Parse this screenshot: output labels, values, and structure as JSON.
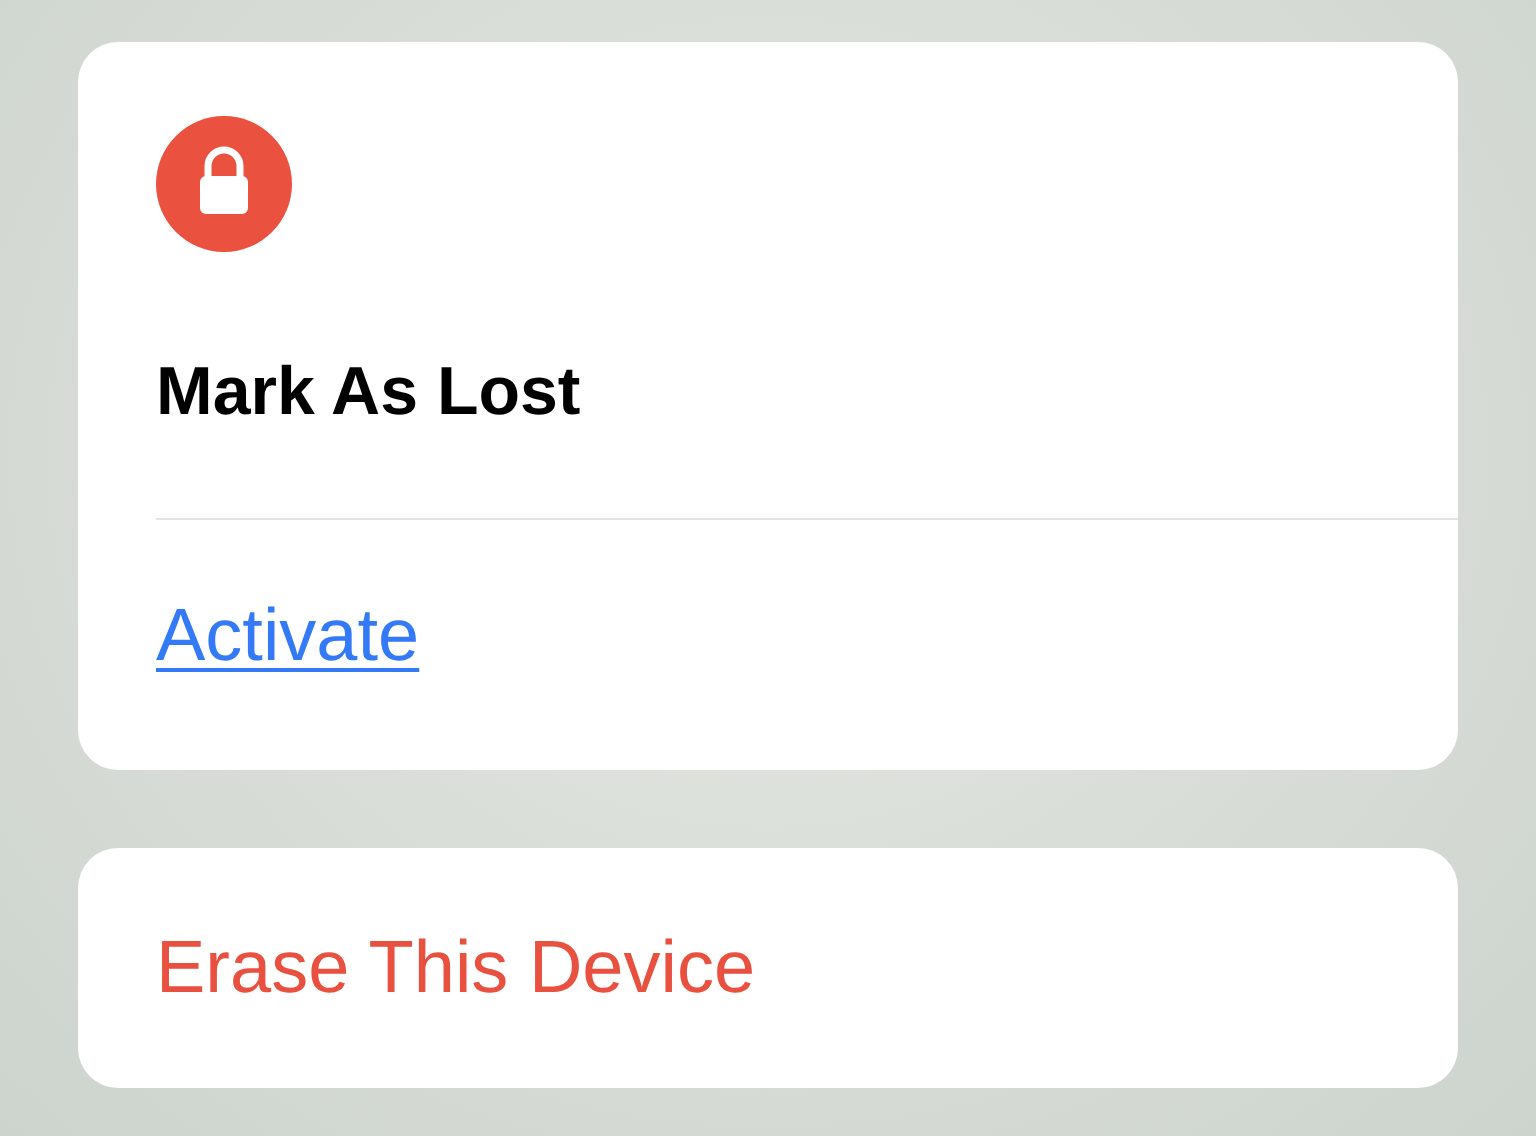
{
  "lost_mode": {
    "title": "Mark As Lost",
    "link": "Activate"
  },
  "erase_button": {
    "label": "Erase This Device"
  }
}
